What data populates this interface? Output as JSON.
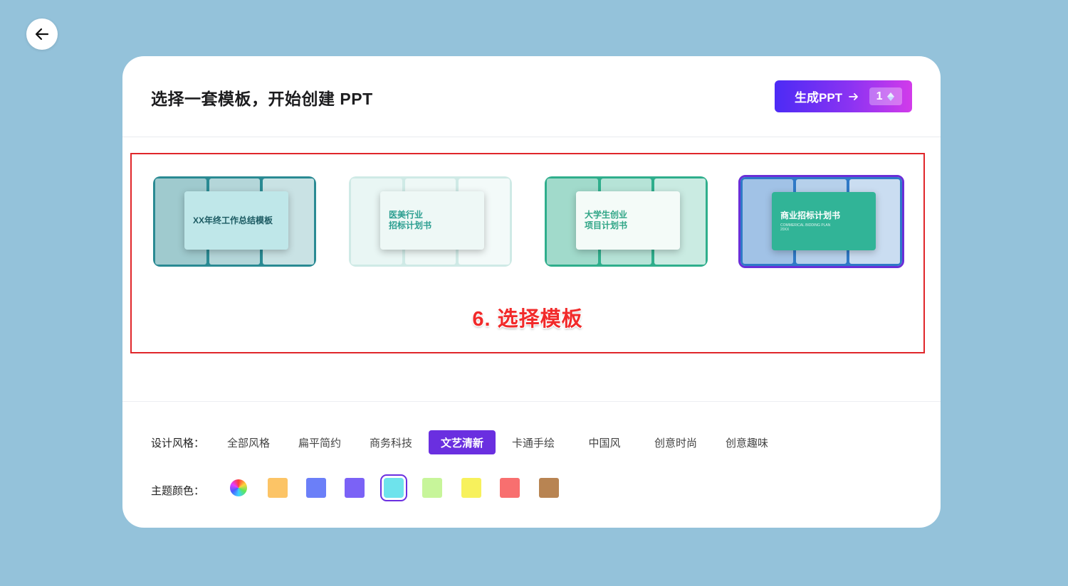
{
  "header": {
    "title": "选择一套模板，开始创建 PPT"
  },
  "generate": {
    "label": "生成PPT",
    "count": "1",
    "gem_icon": "gem-icon"
  },
  "annotation": {
    "text": "6. 选择模板"
  },
  "templates": [
    {
      "title": "XX年终工作总结模板",
      "subtitle": "",
      "selected": false,
      "colors": {
        "bg": "#2a8a93",
        "card": "#bfe7e9",
        "text": "#1d5b63"
      }
    },
    {
      "title": "医美行业\n招标计划书",
      "subtitle": "",
      "selected": false,
      "colors": {
        "bg": "#cfeae6",
        "card": "#eef8f6",
        "text": "#2b9e90"
      }
    },
    {
      "title": "大学生创业\n项目计划书",
      "subtitle": "",
      "selected": false,
      "colors": {
        "bg": "#2fae8c",
        "card": "#f4fbf8",
        "text": "#2fa586"
      }
    },
    {
      "title": "商业招标计划书",
      "subtitle": "COMMERICAL BIDDING PLAN\n20XX",
      "selected": true,
      "colors": {
        "bg": "#2f79c7",
        "card": "#31b497",
        "text": "#ffffff"
      }
    }
  ],
  "filters": {
    "style_label": "设计风格：",
    "styles": [
      "全部风格",
      "扁平简约",
      "商务科技",
      "文艺清新",
      "卡通手绘",
      "中国风",
      "创意时尚",
      "创意趣味"
    ],
    "active_style": "文艺清新",
    "color_label": "主题颜色：",
    "colors": [
      "#rainbow",
      "#fcc466",
      "#6b7ff8",
      "#7b62f6",
      "#6ee3ec",
      "#c7f59a",
      "#f7f15c",
      "#f86f6f",
      "#b88452"
    ],
    "active_color": "#6ee3ec"
  }
}
